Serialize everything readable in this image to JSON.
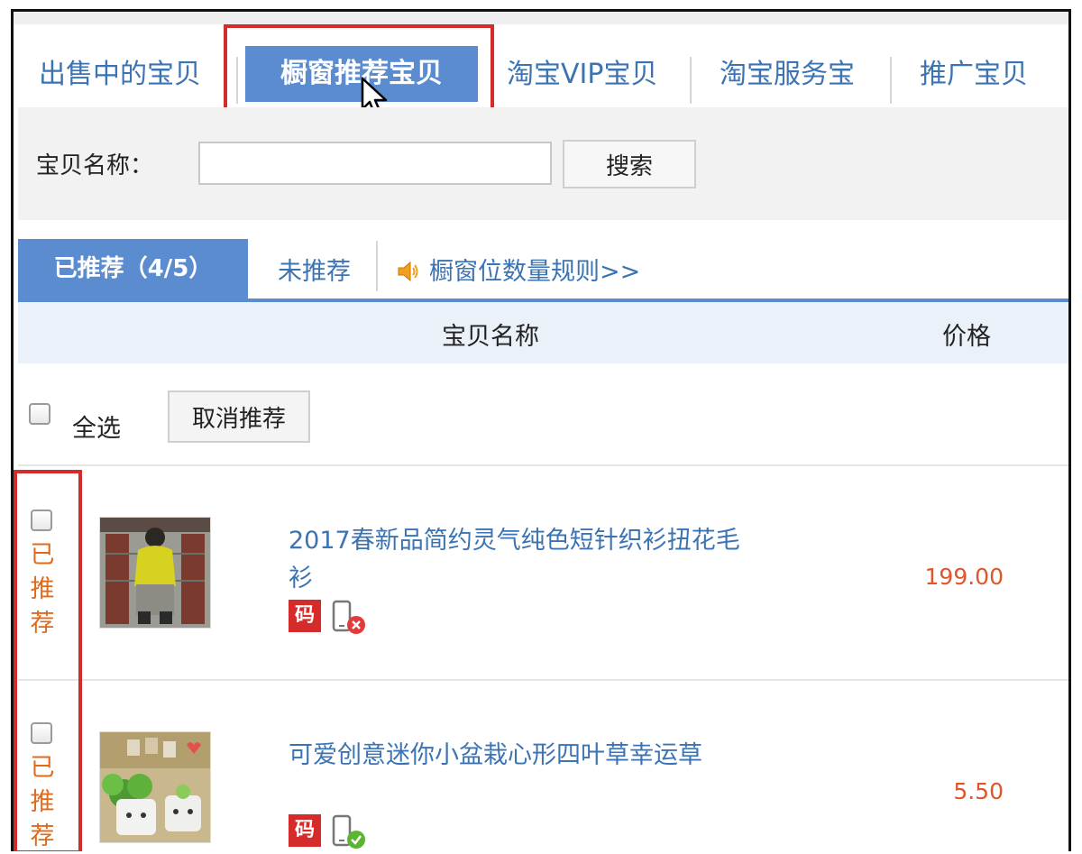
{
  "main_tabs": [
    {
      "label": "出售中的宝贝",
      "active": false
    },
    {
      "label": "橱窗推荐宝贝",
      "active": true
    },
    {
      "label": "淘宝VIP宝贝",
      "active": false
    },
    {
      "label": "淘宝服务宝",
      "active": false
    },
    {
      "label": "推广宝贝",
      "active": false
    }
  ],
  "search": {
    "label": "宝贝名称：",
    "input_value": "",
    "button_label": "搜索"
  },
  "sub_tabs": {
    "recommended": "已推荐（4/5）",
    "not_recommended": "未推荐",
    "rules_link": "橱窗位数量规则>>"
  },
  "table_header": {
    "name": "宝贝名称",
    "price": "价格"
  },
  "bulk_actions": {
    "select_all": "全选",
    "cancel_label": "取消推荐"
  },
  "items": [
    {
      "status": "已推荐",
      "title": "2017春新品简约灵气纯色短针织衫扭花毛衫",
      "code_badge": "码",
      "mobile_icon": "mobile-unavailable-icon",
      "price": "199.00"
    },
    {
      "status": "已推荐",
      "title": "可爱创意迷你小盆栽心形四叶草幸运草",
      "code_badge": "码",
      "mobile_icon": "mobile-available-icon",
      "price": "5.50"
    }
  ],
  "colors": {
    "accent_blue": "#5b8ccf",
    "link_blue": "#3b73b3",
    "highlight_red": "#d62b2b",
    "status_orange": "#e06a1c",
    "price_orange": "#e0552a"
  }
}
